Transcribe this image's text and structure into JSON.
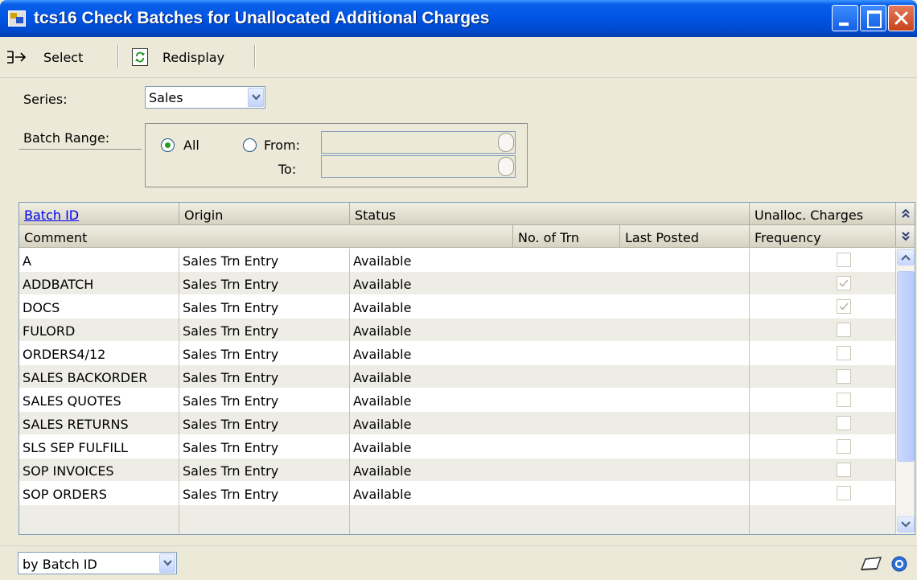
{
  "window": {
    "title": "tcs16 Check Batches for Unallocated Additional Charges"
  },
  "toolbar": {
    "select_label": "Select",
    "redisplay_label": "Redisplay"
  },
  "filters": {
    "series_label": "Series:",
    "series_value": "Sales",
    "batch_range_label": "Batch Range:",
    "all_label": "All",
    "from_label": "From:",
    "to_label": "To:",
    "from_value": "",
    "to_value": "",
    "selected_range": "All"
  },
  "grid": {
    "headers_row1": [
      "Batch ID",
      "Origin",
      "Status",
      "Unalloc. Charges"
    ],
    "headers_row2": [
      "Comment",
      "No. of Trn",
      "Last Posted",
      "Frequency"
    ],
    "rows": [
      {
        "batch_id": "A",
        "origin": "Sales Trn Entry",
        "status": "Available",
        "unalloc": false
      },
      {
        "batch_id": "ADDBATCH",
        "origin": "Sales Trn Entry",
        "status": "Available",
        "unalloc": true
      },
      {
        "batch_id": "DOCS",
        "origin": "Sales Trn Entry",
        "status": "Available",
        "unalloc": true
      },
      {
        "batch_id": "FULORD",
        "origin": "Sales Trn Entry",
        "status": "Available",
        "unalloc": false
      },
      {
        "batch_id": "ORDERS4/12",
        "origin": "Sales Trn Entry",
        "status": "Available",
        "unalloc": false
      },
      {
        "batch_id": "SALES BACKORDER",
        "origin": "Sales Trn Entry",
        "status": "Available",
        "unalloc": false
      },
      {
        "batch_id": "SALES QUOTES",
        "origin": "Sales Trn Entry",
        "status": "Available",
        "unalloc": false
      },
      {
        "batch_id": "SALES RETURNS",
        "origin": "Sales Trn Entry",
        "status": "Available",
        "unalloc": false
      },
      {
        "batch_id": "SLS SEP FULFILL",
        "origin": "Sales Trn Entry",
        "status": "Available",
        "unalloc": false
      },
      {
        "batch_id": "SOP INVOICES",
        "origin": "Sales Trn Entry",
        "status": "Available",
        "unalloc": false
      },
      {
        "batch_id": "SOP ORDERS",
        "origin": "Sales Trn Entry",
        "status": "Available",
        "unalloc": false
      }
    ]
  },
  "footer": {
    "sort_value": "by Batch ID"
  },
  "icons": {
    "app": "window-app-icon",
    "select": "select-arrow-icon",
    "redisplay": "redisplay-icon",
    "note": "note-icon",
    "help": "help-icon"
  },
  "colors": {
    "title_bar": "#0054e3",
    "window_bg": "#ece9d8",
    "link": "#0000ee",
    "radio_dot": "#21a121",
    "close_button": "#c7431c"
  }
}
